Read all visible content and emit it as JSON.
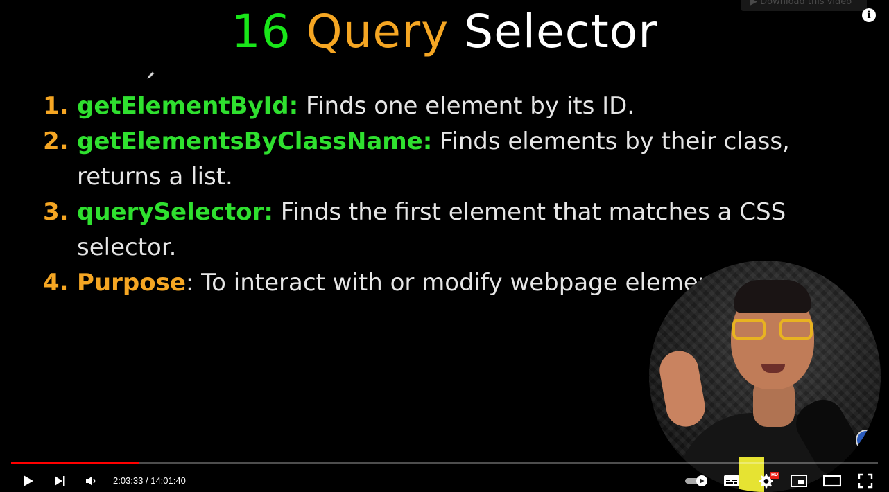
{
  "slide": {
    "title_number": "16",
    "title_word1": "Query",
    "title_word2": "Selector",
    "items": [
      {
        "num": "1.",
        "keyword": "getElementById",
        "sep": ":",
        "text": " Finds one element by its ID."
      },
      {
        "num": "2.",
        "keyword": "getElementsByClassName",
        "sep": ":",
        "text": " Finds elements by their class, returns a list."
      },
      {
        "num": "3.",
        "keyword": "querySelector",
        "sep": ":",
        "text": " Finds the first element that matches a CSS selector."
      },
      {
        "num": "4.",
        "keyword": "Purpose",
        "sep": ":",
        "text": " To interact with or modify webpage elements."
      }
    ]
  },
  "overlay": {
    "download_label": "▶ Download this video",
    "info_label": "i"
  },
  "player": {
    "current_time": "2:03:33",
    "duration": "14:01:40",
    "time_display": "2:03:33 / 14:01:40",
    "progress_fraction": 0.147,
    "hd_badge": "HD",
    "progress_color": "#ff0000"
  },
  "icons": [
    "play-icon",
    "next-icon",
    "volume-icon",
    "autoplay-toggle-icon",
    "subtitles-icon",
    "settings-icon",
    "miniplayer-icon",
    "theater-mode-icon",
    "fullscreen-icon",
    "info-icon",
    "pen-cursor-icon"
  ]
}
